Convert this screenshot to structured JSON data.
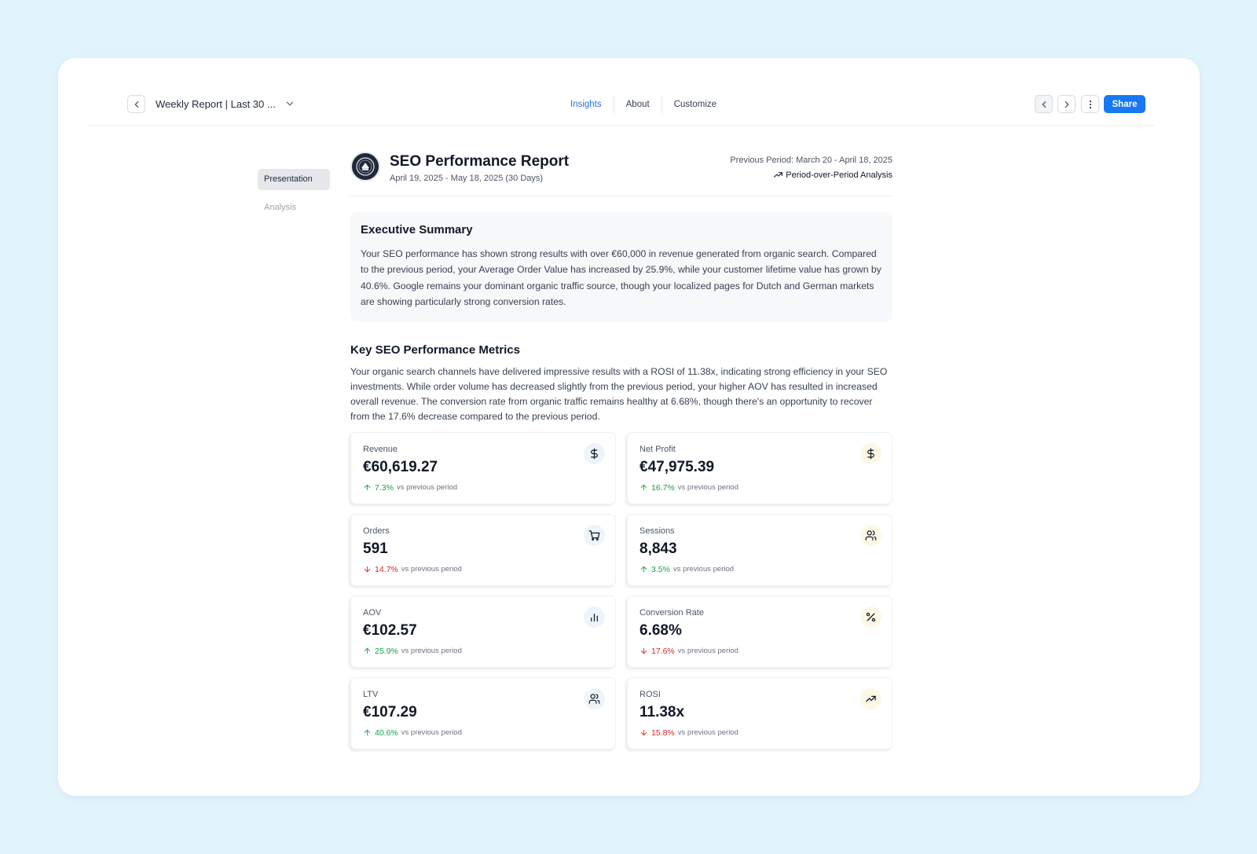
{
  "header": {
    "report_title": "Weekly Report | Last 30 ...",
    "tabs": [
      {
        "label": "Insights",
        "active": true
      },
      {
        "label": "About",
        "active": false
      },
      {
        "label": "Customize",
        "active": false
      }
    ],
    "share_label": "Share"
  },
  "sidenav": {
    "items": [
      {
        "label": "Presentation",
        "active": true
      },
      {
        "label": "Analysis",
        "active": false
      }
    ]
  },
  "report": {
    "title": "SEO Performance Report",
    "date_range": "April 19, 2025 - May 18, 2025 (30 Days)",
    "previous_period": "Previous Period: March 20 - April 18, 2025",
    "analysis_label": "Period-over-Period Analysis"
  },
  "executive_summary": {
    "title": "Executive Summary",
    "text": "Your SEO performance has shown strong results with over €60,000 in revenue generated from organic search. Compared to the previous period, your Average Order Value has increased by 25.9%, while your customer lifetime value has grown by 40.6%. Google remains your dominant organic traffic source, though your localized pages for Dutch and German markets are showing particularly strong conversion rates."
  },
  "metrics_section": {
    "title": "Key SEO Performance Metrics",
    "text": "Your organic search channels have delivered impressive results with a ROSI of 11.38x, indicating strong efficiency in your SEO investments. While order volume has decreased slightly from the previous period, your higher AOV has resulted in increased overall revenue. The conversion rate from organic traffic remains healthy at 6.68%, though there's an opportunity to recover from the 17.6% decrease compared to the previous period."
  },
  "metrics": [
    {
      "label": "Revenue",
      "value": "€60,619.27",
      "change": "7.3%",
      "direction": "up",
      "vs": "vs previous period",
      "icon": "dollar-icon"
    },
    {
      "label": "Net Profit",
      "value": "€47,975.39",
      "change": "16.7%",
      "direction": "up",
      "vs": "vs previous period",
      "icon": "dollar-icon"
    },
    {
      "label": "Orders",
      "value": "591",
      "change": "14.7%",
      "direction": "down",
      "vs": "vs previous period",
      "icon": "cart-icon"
    },
    {
      "label": "Sessions",
      "value": "8,843",
      "change": "3.5%",
      "direction": "up",
      "vs": "vs previous period",
      "icon": "users-icon"
    },
    {
      "label": "AOV",
      "value": "€102.57",
      "change": "25.9%",
      "direction": "up",
      "vs": "vs previous period",
      "icon": "bar-chart-icon"
    },
    {
      "label": "Conversion Rate",
      "value": "6.68%",
      "change": "17.6%",
      "direction": "down",
      "vs": "vs previous period",
      "icon": "percent-icon"
    },
    {
      "label": "LTV",
      "value": "€107.29",
      "change": "40.6%",
      "direction": "up",
      "vs": "vs previous period",
      "icon": "users-icon"
    },
    {
      "label": "ROSI",
      "value": "11.38x",
      "change": "15.8%",
      "direction": "down",
      "vs": "vs previous period",
      "icon": "trending-up-icon"
    }
  ],
  "colors": {
    "background": "#e1f4fc",
    "accent": "#1778f2",
    "active_tab": "#2f6fde",
    "positive": "#16a34a",
    "negative": "#dc2626"
  }
}
